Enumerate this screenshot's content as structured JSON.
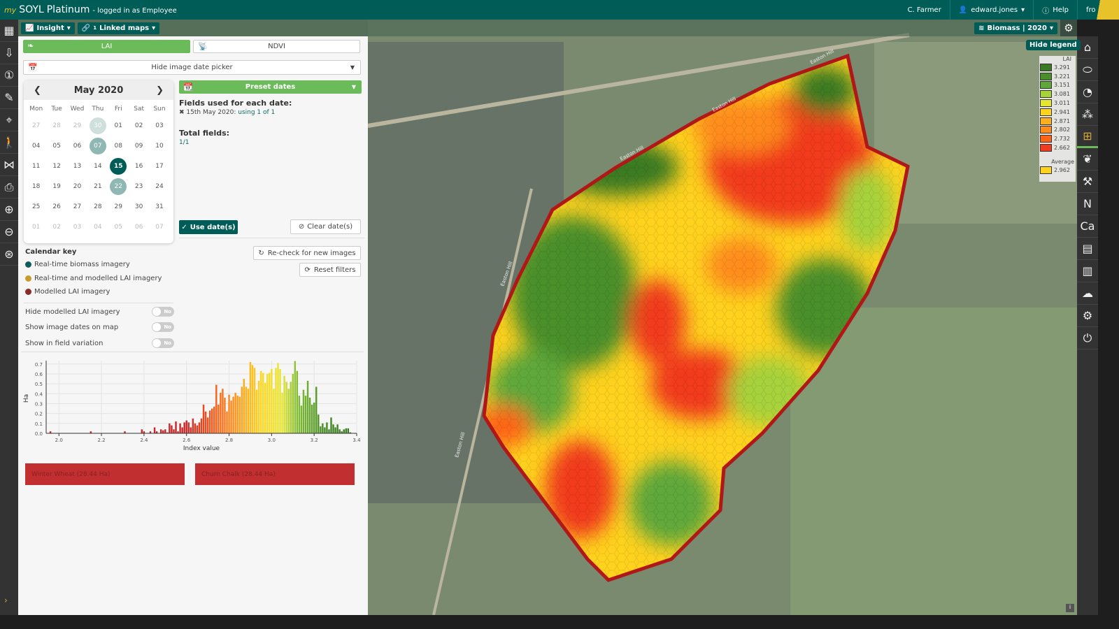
{
  "header": {
    "brand_prefix": "my",
    "brand": "SOYL",
    "product": "Platinum",
    "logged_in": "- logged in as Employee",
    "farm": "C. Farmer",
    "user": "edward.jones",
    "help": "Help",
    "partner_logo": "frontier"
  },
  "toolbar": {
    "insight": "Insight",
    "linked_maps": "Linked maps",
    "linked_count": "1",
    "layer": "Biomass | 2020"
  },
  "panel": {
    "lai_tab": "LAI",
    "ndvi_tab": "NDVI",
    "date_picker_toggle": "Hide image date picker",
    "calendar": {
      "month": "May 2020",
      "dow": [
        "Mon",
        "Tue",
        "Wed",
        "Thu",
        "Fri",
        "Sat",
        "Sun"
      ],
      "days": [
        [
          "27",
          "m"
        ],
        [
          "28",
          "m"
        ],
        [
          "29",
          "m"
        ],
        [
          "30",
          "m2"
        ],
        [
          "01",
          ""
        ],
        [
          "02",
          ""
        ],
        [
          "03",
          ""
        ],
        [
          "04",
          ""
        ],
        [
          "05",
          ""
        ],
        [
          "06",
          ""
        ],
        [
          "07",
          "d1"
        ],
        [
          "08",
          ""
        ],
        [
          "09",
          ""
        ],
        [
          "10",
          ""
        ],
        [
          "11",
          ""
        ],
        [
          "12",
          ""
        ],
        [
          "13",
          ""
        ],
        [
          "14",
          ""
        ],
        [
          "15",
          "sel"
        ],
        [
          "16",
          ""
        ],
        [
          "17",
          ""
        ],
        [
          "18",
          ""
        ],
        [
          "19",
          ""
        ],
        [
          "20",
          ""
        ],
        [
          "21",
          ""
        ],
        [
          "22",
          "d1"
        ],
        [
          "23",
          ""
        ],
        [
          "24",
          ""
        ],
        [
          "25",
          ""
        ],
        [
          "26",
          ""
        ],
        [
          "27",
          ""
        ],
        [
          "28",
          ""
        ],
        [
          "29",
          ""
        ],
        [
          "30",
          ""
        ],
        [
          "31",
          ""
        ],
        [
          "01",
          "m"
        ],
        [
          "02",
          "m"
        ],
        [
          "03",
          "m"
        ],
        [
          "04",
          "m"
        ],
        [
          "05",
          "m"
        ],
        [
          "06",
          "m"
        ],
        [
          "07",
          "m"
        ]
      ]
    },
    "preset_dates": "Preset dates",
    "fields_used_title": "Fields used for each date:",
    "fields_used_date": "15th May 2020:",
    "fields_used_value": "using 1 of 1",
    "total_fields_title": "Total fields:",
    "total_fields_value": "1/1",
    "use_dates": "Use date(s)",
    "clear_dates": "Clear date(s)",
    "recheck": "Re-check for new images",
    "reset_filters": "Reset filters",
    "calendar_key": {
      "title": "Calendar key",
      "items": [
        {
          "label": "Real-time biomass imagery",
          "color": "#0d5d58"
        },
        {
          "label": "Real-time and modelled LAI imagery",
          "color": "#c99a2e"
        },
        {
          "label": "Modelled LAI imagery",
          "color": "#8a2a2a"
        }
      ]
    },
    "toggles": [
      {
        "label": "Hide modelled LAI imagery",
        "state": "No"
      },
      {
        "label": "Show image dates on map",
        "state": "No"
      },
      {
        "label": "Show in field variation",
        "state": "No"
      }
    ],
    "crops": [
      "Winter Wheat (28.44 Ha)",
      "Churn Chalk (28.44 Ha)"
    ]
  },
  "chart_data": {
    "type": "bar",
    "xlabel": "Index value",
    "ylabel": "Ha",
    "xlim": [
      1.94,
      3.4
    ],
    "ylim": [
      0,
      0.72
    ],
    "xticks": [
      "2.0",
      "2.2",
      "2.4",
      "2.6",
      "2.8",
      "3.0",
      "3.2",
      "3.4"
    ],
    "yticks": [
      "0.0",
      "0.1",
      "0.2",
      "0.3",
      "0.4",
      "0.5",
      "0.6",
      "0.7"
    ],
    "grid": true,
    "bins": [
      [
        1.96,
        0.02
      ],
      [
        2.15,
        0.02
      ],
      [
        2.31,
        0.02
      ],
      [
        2.39,
        0.04
      ],
      [
        2.4,
        0.02
      ],
      [
        2.43,
        0.02
      ],
      [
        2.45,
        0.06
      ],
      [
        2.46,
        0.02
      ],
      [
        2.48,
        0.04
      ],
      [
        2.49,
        0.03
      ],
      [
        2.5,
        0.04
      ],
      [
        2.51,
        0.01
      ],
      [
        2.52,
        0.1
      ],
      [
        2.53,
        0.08
      ],
      [
        2.54,
        0.04
      ],
      [
        2.55,
        0.12
      ],
      [
        2.56,
        0.02
      ],
      [
        2.57,
        0.1
      ],
      [
        2.58,
        0.06
      ],
      [
        2.59,
        0.11
      ],
      [
        2.6,
        0.13
      ],
      [
        2.61,
        0.11
      ],
      [
        2.62,
        0.06
      ],
      [
        2.63,
        0.15
      ],
      [
        2.64,
        0.1
      ],
      [
        2.65,
        0.08
      ],
      [
        2.66,
        0.11
      ],
      [
        2.67,
        0.15
      ],
      [
        2.68,
        0.29
      ],
      [
        2.69,
        0.22
      ],
      [
        2.7,
        0.16
      ],
      [
        2.71,
        0.23
      ],
      [
        2.72,
        0.25
      ],
      [
        2.73,
        0.27
      ],
      [
        2.74,
        0.49
      ],
      [
        2.75,
        0.29
      ],
      [
        2.76,
        0.41
      ],
      [
        2.77,
        0.45
      ],
      [
        2.78,
        0.36
      ],
      [
        2.79,
        0.22
      ],
      [
        2.8,
        0.39
      ],
      [
        2.81,
        0.33
      ],
      [
        2.82,
        0.37
      ],
      [
        2.83,
        0.41
      ],
      [
        2.84,
        0.38
      ],
      [
        2.85,
        0.37
      ],
      [
        2.86,
        0.47
      ],
      [
        2.87,
        0.55
      ],
      [
        2.88,
        0.47
      ],
      [
        2.89,
        0.45
      ],
      [
        2.9,
        0.72
      ],
      [
        2.91,
        0.69
      ],
      [
        2.92,
        0.66
      ],
      [
        2.93,
        0.44
      ],
      [
        2.94,
        0.53
      ],
      [
        2.95,
        0.63
      ],
      [
        2.96,
        0.61
      ],
      [
        2.97,
        0.51
      ],
      [
        2.98,
        0.6
      ],
      [
        2.99,
        0.61
      ],
      [
        3.0,
        0.65
      ],
      [
        3.01,
        0.45
      ],
      [
        3.02,
        0.66
      ],
      [
        3.03,
        0.71
      ],
      [
        3.04,
        0.65
      ],
      [
        3.05,
        0.41
      ],
      [
        3.06,
        0.58
      ],
      [
        3.07,
        0.52
      ],
      [
        3.08,
        0.45
      ],
      [
        3.09,
        0.52
      ],
      [
        3.1,
        0.6
      ],
      [
        3.11,
        0.73
      ],
      [
        3.12,
        0.63
      ],
      [
        3.13,
        0.38
      ],
      [
        3.14,
        0.28
      ],
      [
        3.15,
        0.44
      ],
      [
        3.16,
        0.38
      ],
      [
        3.17,
        0.53
      ],
      [
        3.18,
        0.36
      ],
      [
        3.19,
        0.29
      ],
      [
        3.2,
        0.31
      ],
      [
        3.21,
        0.47
      ],
      [
        3.22,
        0.19
      ],
      [
        3.23,
        0.07
      ],
      [
        3.24,
        0.1
      ],
      [
        3.25,
        0.06
      ],
      [
        3.26,
        0.11
      ],
      [
        3.27,
        0.04
      ],
      [
        3.28,
        0.16
      ],
      [
        3.29,
        0.09
      ],
      [
        3.3,
        0.06
      ],
      [
        3.31,
        0.09
      ],
      [
        3.32,
        0.04
      ],
      [
        3.33,
        0.02
      ],
      [
        3.34,
        0.04
      ],
      [
        3.35,
        0.05
      ],
      [
        3.36,
        0.05
      ],
      [
        3.37,
        0.01
      ]
    ]
  },
  "legend": {
    "hide_label": "Hide legend",
    "title": "LAI",
    "items": [
      {
        "value": "3.291",
        "color": "#3a7a22"
      },
      {
        "value": "3.221",
        "color": "#4a8f2a"
      },
      {
        "value": "3.151",
        "color": "#5ea83a"
      },
      {
        "value": "3.081",
        "color": "#a6d23a"
      },
      {
        "value": "3.011",
        "color": "#e6e632"
      },
      {
        "value": "2.941",
        "color": "#ffd21e"
      },
      {
        "value": "2.871",
        "color": "#ffae1e"
      },
      {
        "value": "2.802",
        "color": "#ff8c1a"
      },
      {
        "value": "2.732",
        "color": "#ff6414"
      },
      {
        "value": "2.662",
        "color": "#f23a1e"
      }
    ],
    "average_label": "Average",
    "average_value": "2.962",
    "average_color": "#ffd21e"
  },
  "map": {
    "road_labels": [
      "Easton Hill",
      "Easton Hill",
      "Easton Hill",
      "Easton Hill",
      "Easton Hill"
    ],
    "field_outline_color": "#b01818"
  }
}
